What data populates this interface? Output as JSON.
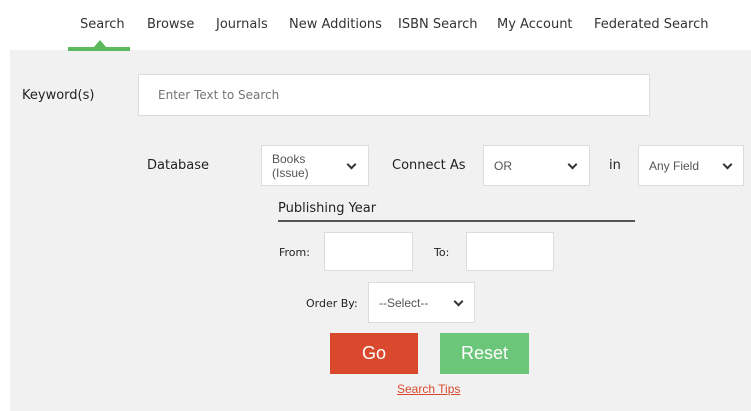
{
  "nav": {
    "items": [
      "Search",
      "Browse",
      "Journals",
      "New Additions",
      "ISBN Search",
      "My Account",
      "Federated Search"
    ],
    "active": "Search"
  },
  "form": {
    "keyword_label": "Keyword(s)",
    "keyword_placeholder": "Enter Text to Search",
    "database_label": "Database",
    "database_value_line1": "Books",
    "database_value_line2": "(Issue)",
    "connect_label": "Connect As",
    "connect_value": "OR",
    "in_label": "in",
    "field_value": "Any Field",
    "publishing_year_heading": "Publishing Year",
    "from_label": "From:",
    "to_label": "To:",
    "order_label": "Order By:",
    "order_value": "--Select--"
  },
  "buttons": {
    "go": "Go",
    "reset": "Reset"
  },
  "links": {
    "search_tips": "Search Tips"
  },
  "colors": {
    "accent_green": "#5cb85c",
    "go_red": "#d9492e",
    "reset_green": "#6cc67a",
    "page_bg": "#f1f1f1"
  }
}
